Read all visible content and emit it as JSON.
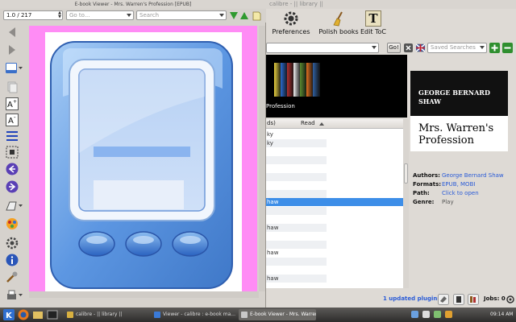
{
  "calibre": {
    "title": "calibre - || library ||",
    "toolbar": [
      {
        "label": "Preferences",
        "icon": "gear-icon"
      },
      {
        "label": "Polish books",
        "icon": "broom-icon"
      },
      {
        "label": "Edit ToC",
        "icon": "toc-icon",
        "glyph": "T"
      }
    ],
    "search": {
      "go_label": "Go!",
      "saved_placeholder": "Saved Searches"
    },
    "cover_caption": "Profession",
    "cover_colors": [
      "#e8d040",
      "#2a6ad0",
      "#b03030",
      "#f0f0f0",
      "#5a8a30",
      "#e07020",
      "#3060a0"
    ],
    "right_cover": {
      "author": "GEORGE BERNARD SHAW",
      "title": "Mrs. Warren's Profession"
    },
    "list": {
      "col_title": "ds)",
      "col_read": "Read",
      "rows": [
        "ky",
        "ky",
        "",
        "",
        "",
        "",
        "",
        "",
        "haw",
        "",
        "",
        "haw",
        "",
        "",
        "haw",
        "",
        "",
        "haw",
        "",
        ""
      ]
    },
    "details": [
      {
        "key": "Authors:",
        "value": "George Bernard Shaw",
        "link": true
      },
      {
        "key": "Formats:",
        "value": "EPUB, MOBI",
        "link": true
      },
      {
        "key": "Path:",
        "value": "Click to open",
        "link": true
      },
      {
        "key": "Genre:",
        "value": "Play",
        "link": false
      }
    ],
    "status": {
      "updated_plugins": "1 updated plugins",
      "jobs": "Jobs: 0"
    }
  },
  "viewer": {
    "title": "E-book Viewer - Mrs. Warren's Profession [EPUB]",
    "page_value": "1.0 / 217",
    "goto_placeholder": "Go to...",
    "search_placeholder": "Search",
    "page_bg": "#ff8cf5"
  },
  "taskbar": {
    "tasks": [
      {
        "label": "calibre - || library ||",
        "active": false
      },
      {
        "label": "Viewer - calibre : e-book ma...",
        "active": false
      },
      {
        "label": "E-book Viewer - Mrs. Warren's Pr...",
        "active": true
      }
    ],
    "clock": "09:14 AM"
  }
}
